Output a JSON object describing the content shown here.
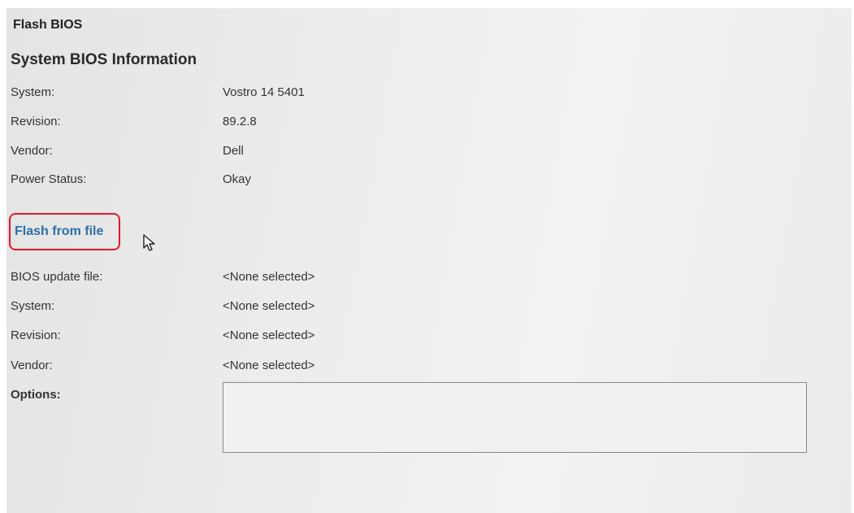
{
  "page_title": "Flash BIOS",
  "system_info": {
    "heading": "System BIOS Information",
    "rows": [
      {
        "label": "System:",
        "value": "Vostro 14 5401"
      },
      {
        "label": "Revision:",
        "value": "89.2.8"
      },
      {
        "label": "Vendor:",
        "value": "Dell"
      },
      {
        "label": "Power Status:",
        "value": "Okay"
      }
    ]
  },
  "flash": {
    "link_label": "Flash from file",
    "highlight_color": "#e2182d",
    "link_color": "#2b6fa6",
    "rows": [
      {
        "label": "BIOS update file:",
        "value": "<None selected>"
      },
      {
        "label": "System:",
        "value": "<None selected>"
      },
      {
        "label": "Revision:",
        "value": "<None selected>"
      },
      {
        "label": "Vendor:",
        "value": "<None selected>"
      }
    ],
    "options_label": "Options:"
  },
  "cursor_icon": "mouse-pointer-icon"
}
